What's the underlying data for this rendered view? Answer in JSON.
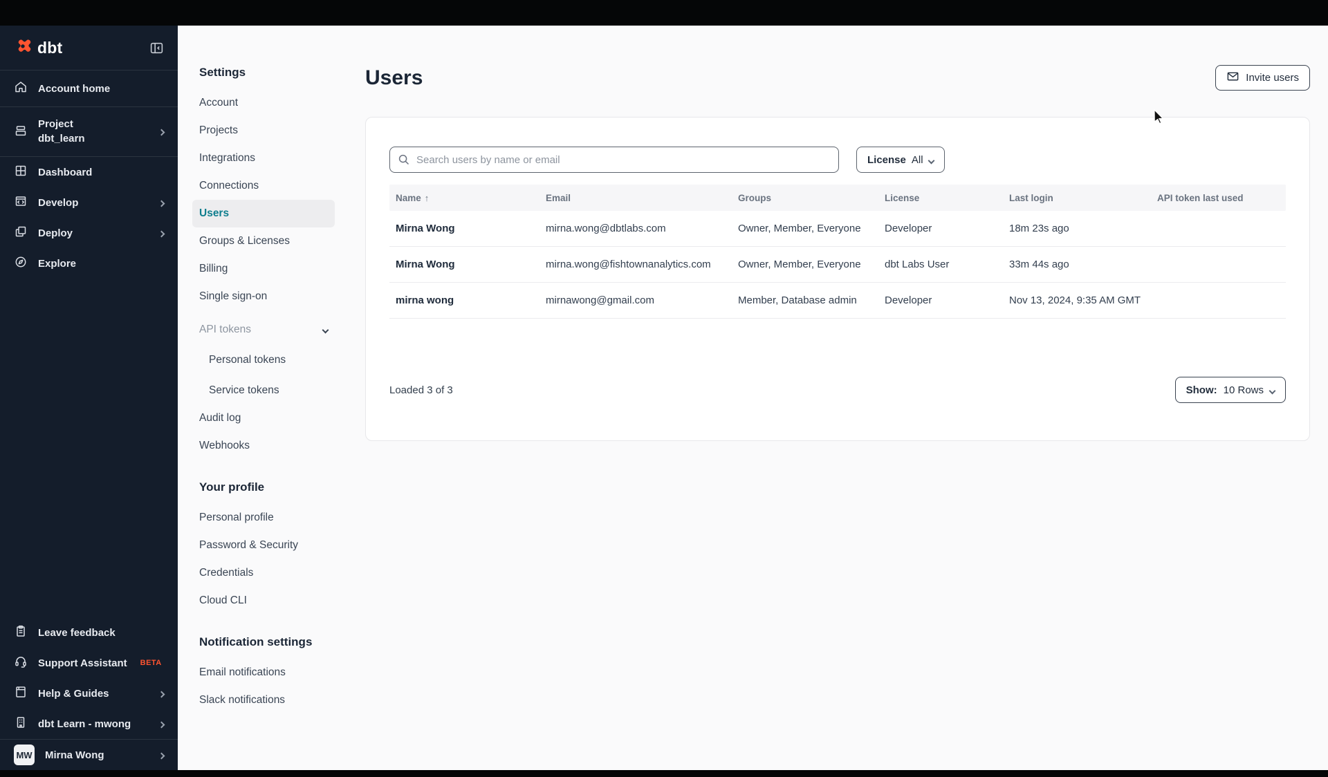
{
  "sidebar": {
    "logo": "dbt",
    "nav": [
      {
        "label": "Account home"
      },
      {
        "label": "Project",
        "sublabel": "dbt_learn"
      },
      {
        "label": "Dashboard"
      },
      {
        "label": "Develop"
      },
      {
        "label": "Deploy"
      },
      {
        "label": "Explore"
      }
    ],
    "footer": [
      {
        "label": "Leave feedback"
      },
      {
        "label": "Support Assistant",
        "badge": "BETA"
      },
      {
        "label": "Help & Guides"
      },
      {
        "label": "dbt Learn - mwong"
      }
    ],
    "user": {
      "initials": "MW",
      "name": "Mirna Wong"
    }
  },
  "settings_nav": {
    "title": "Settings",
    "items": [
      "Account",
      "Projects",
      "Integrations",
      "Connections",
      "Users",
      "Groups & Licenses",
      "Billing",
      "Single sign-on"
    ],
    "active_item": "Users",
    "api_tokens": {
      "label": "API tokens",
      "children": [
        "Personal tokens",
        "Service tokens"
      ]
    },
    "items_after": [
      "Audit log",
      "Webhooks"
    ],
    "profile": {
      "title": "Your profile",
      "items": [
        "Personal profile",
        "Password & Security",
        "Credentials",
        "Cloud CLI"
      ]
    },
    "notifications": {
      "title": "Notification settings",
      "items": [
        "Email notifications",
        "Slack notifications"
      ]
    }
  },
  "main": {
    "title": "Users",
    "invite_button": "Invite users",
    "search_placeholder": "Search users by name or email",
    "license_filter": {
      "label": "License",
      "value": "All"
    },
    "table": {
      "headers": [
        "Name",
        "Email",
        "Groups",
        "License",
        "Last login",
        "API token last used"
      ],
      "sort": {
        "column": "Name",
        "direction": "asc"
      },
      "rows": [
        {
          "name": "Mirna Wong",
          "email": "mirna.wong@dbtlabs.com",
          "groups": "Owner, Member, Everyone",
          "license": "Developer",
          "last_login": "18m 23s ago",
          "api_token_last_used": ""
        },
        {
          "name": "Mirna Wong",
          "email": "mirna.wong@fishtownanalytics.com",
          "groups": "Owner, Member, Everyone",
          "license": "dbt Labs User",
          "last_login": "33m 44s ago",
          "api_token_last_used": ""
        },
        {
          "name": "mirna wong",
          "email": "mirnawong@gmail.com",
          "groups": "Member, Database admin",
          "license": "Developer",
          "last_login": "Nov 13, 2024, 9:35 AM GMT",
          "api_token_last_used": ""
        }
      ]
    },
    "footer": {
      "loaded": "Loaded 3 of 3",
      "show_label": "Show:",
      "show_value": "10 Rows"
    }
  },
  "colors": {
    "accent_coral": "#ff5430",
    "active_teal": "#0f7e8e",
    "sidebar_bg": "#141d2b"
  }
}
